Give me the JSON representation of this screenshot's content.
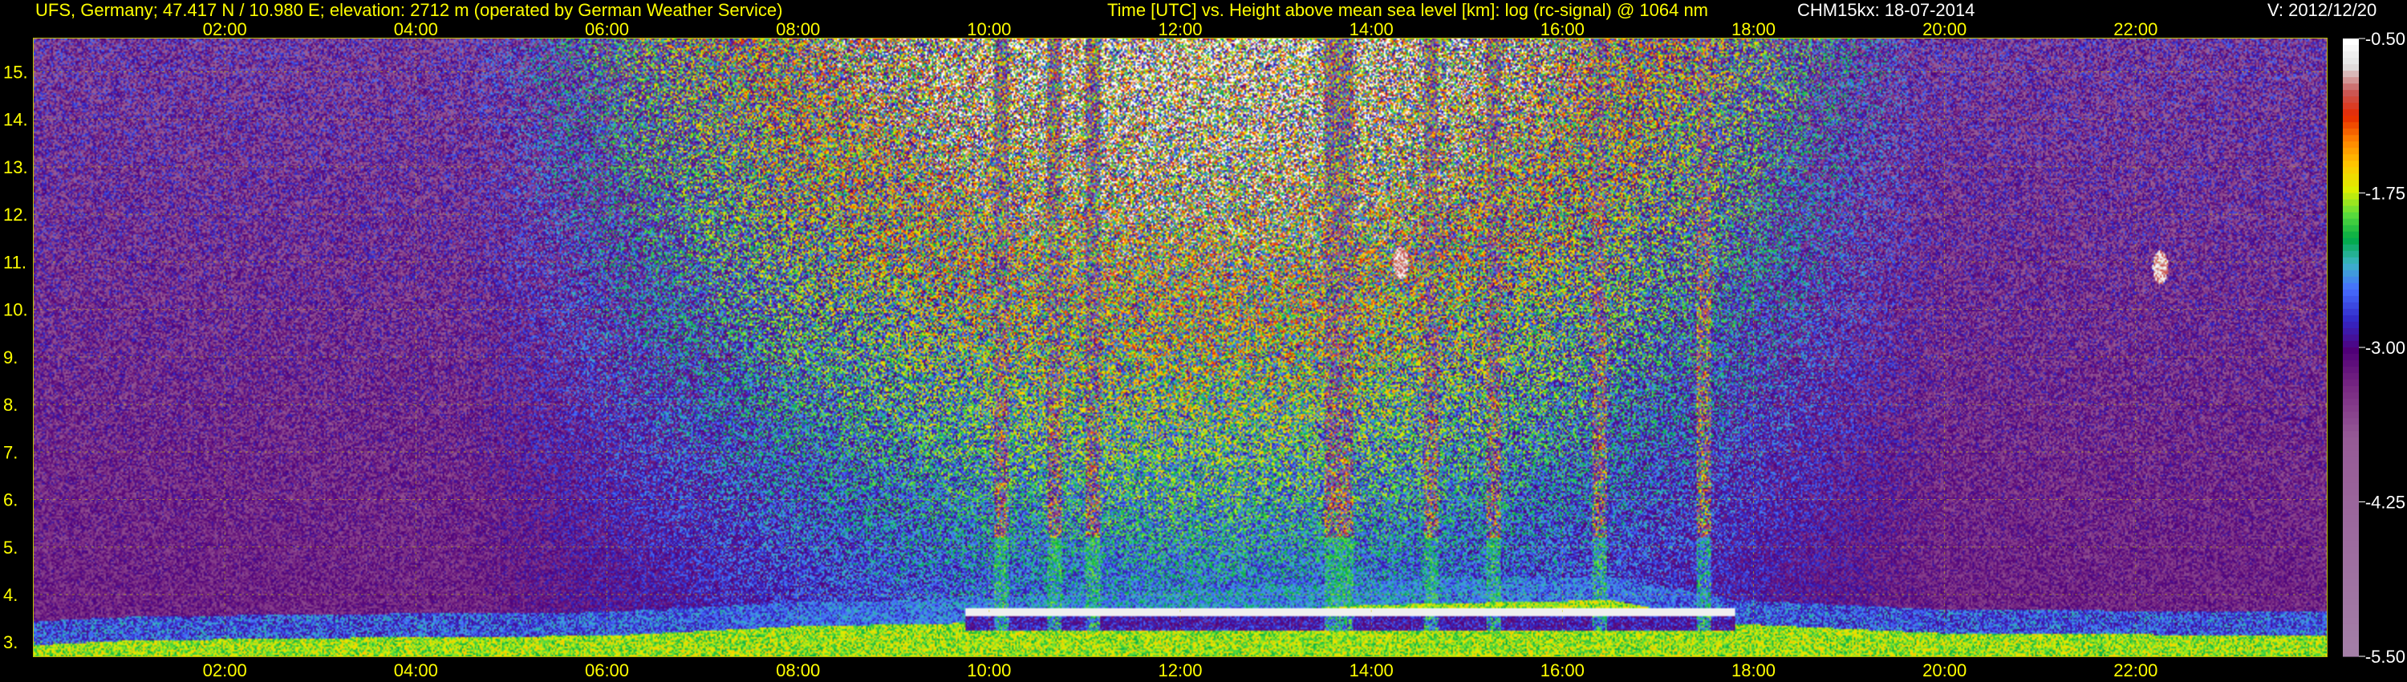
{
  "header": {
    "station": "UFS, Germany; 47.417 N / 10.980 E; elevation: 2712 m  (operated by German Weather Service)",
    "plot_title": "Time [UTC] vs. Height above mean sea level [km]: log (rc-signal) @ 1064 nm",
    "instrument_date": "CHM15kx: 18-07-2014",
    "version": "V: 2012/12/20"
  },
  "colors": {
    "text": "#ffff00",
    "background": "#000000",
    "grid": "#c8c800"
  },
  "chart_data": {
    "type": "heatmap",
    "title": "Time [UTC] vs. Height above mean sea level [km]: log (rc-signal) @ 1064 nm",
    "xlabel": "Time [UTC]",
    "ylabel": "Height above mean sea level [km]",
    "x_unit": "hours UTC",
    "xlim": [
      0,
      24
    ],
    "ylim": [
      2.7,
      15.7
    ],
    "x_ticks": [
      2,
      4,
      6,
      8,
      10,
      12,
      14,
      16,
      18,
      20,
      22
    ],
    "x_tick_labels": [
      "02:00",
      "04:00",
      "06:00",
      "08:00",
      "10:00",
      "12:00",
      "14:00",
      "16:00",
      "18:00",
      "20:00",
      "22:00"
    ],
    "y_ticks": [
      3,
      4,
      5,
      6,
      7,
      8,
      9,
      10,
      11,
      12,
      13,
      14,
      15
    ],
    "y_tick_labels": [
      "3.",
      "4.",
      "5.",
      "6.",
      "7.",
      "8.",
      "9.",
      "10.",
      "11.",
      "12.",
      "13.",
      "14.",
      "15."
    ],
    "grid": true,
    "colorbar": {
      "range": [
        -5.5,
        -0.5
      ],
      "ticks": [
        -0.5,
        -1.75,
        -3.0,
        -4.25,
        -5.5
      ],
      "tick_labels": [
        "-0.50",
        "-1.75",
        "-3.00",
        "-4.25",
        "-5.50"
      ]
    },
    "features": {
      "boundary_layer_top_km": [
        {
          "x": 0.0,
          "y": 2.95
        },
        {
          "x": 1.0,
          "y": 3.05
        },
        {
          "x": 3.0,
          "y": 3.1
        },
        {
          "x": 6.0,
          "y": 3.15
        },
        {
          "x": 8.0,
          "y": 3.35
        },
        {
          "x": 9.5,
          "y": 3.4
        },
        {
          "x": 12.0,
          "y": 3.6
        },
        {
          "x": 14.0,
          "y": 3.8
        },
        {
          "x": 16.5,
          "y": 3.9
        },
        {
          "x": 17.8,
          "y": 3.4
        },
        {
          "x": 20.0,
          "y": 3.2
        },
        {
          "x": 24.0,
          "y": 3.15
        }
      ],
      "cloud_layer": {
        "x_start": 9.75,
        "x_end": 17.8,
        "y_km": 3.65
      },
      "precipitation_gaps": [
        {
          "x_start": 10.05,
          "x_end": 10.2
        },
        {
          "x_start": 10.6,
          "x_end": 10.75
        },
        {
          "x_start": 11.0,
          "x_end": 11.15
        },
        {
          "x_start": 13.5,
          "x_end": 13.8
        },
        {
          "x_start": 14.55,
          "x_end": 14.7
        },
        {
          "x_start": 15.2,
          "x_end": 15.35
        },
        {
          "x_start": 16.3,
          "x_end": 16.45
        },
        {
          "x_start": 17.4,
          "x_end": 17.55
        }
      ],
      "high_echoes": [
        {
          "x": 14.3,
          "y": 11.0
        },
        {
          "x": 22.25,
          "y": 10.9
        }
      ]
    }
  }
}
